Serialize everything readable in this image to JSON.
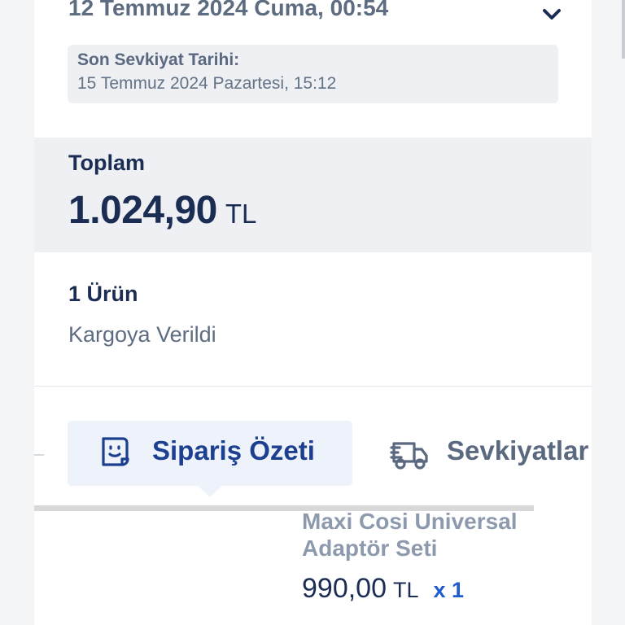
{
  "order": {
    "date": "12 Temmuz 2024 Cuma, 00:54",
    "expand_icon": "chevron-down-icon",
    "last_shipment": {
      "label": "Son Sevkiyat Tarihi:",
      "value": "15 Temmuz 2024 Pazartesi, 15:12"
    },
    "total": {
      "label": "Toplam",
      "amount": "1.024,90",
      "currency": "TL"
    },
    "items_count": "1 Ürün",
    "status": "Kargoya Verildi"
  },
  "tabs": [
    {
      "label": "Sipariş Özeti",
      "icon": "receipt-icon",
      "active": true
    },
    {
      "label": "Sevkiyatlar",
      "icon": "delivery-truck-icon",
      "active": false
    }
  ],
  "product": {
    "name": "Maxi Cosi Universal Adaptör Seti",
    "price": "990,00",
    "currency": "TL",
    "quantity": "x 1"
  },
  "colors": {
    "primary_text": "#1c2d54",
    "secondary_text": "#5d6c80",
    "accent": "#1c3f8f",
    "quantity_blue": "#1f5bd1",
    "panel_gray": "#eef0f3"
  }
}
